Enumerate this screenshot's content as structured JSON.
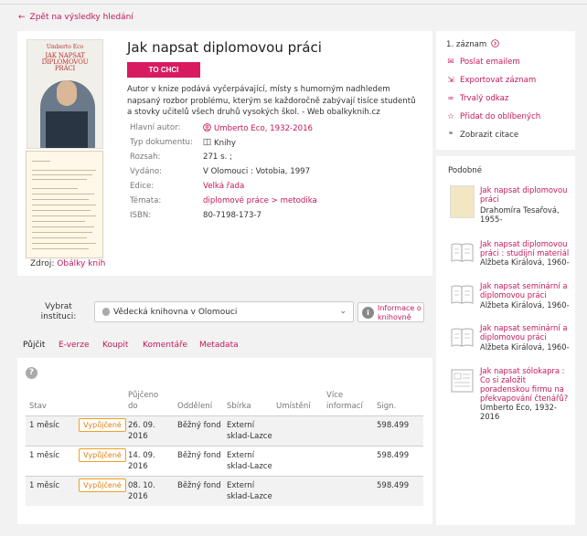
{
  "nav": {
    "back_label": "Zpět na výsledky hledání"
  },
  "record": {
    "cover": {
      "author_text": "Umberto Eco",
      "title_text": "JAK NAPSAT DIPLOMOVOU PRÁCI"
    },
    "title": "Jak napsat diplomovou práci",
    "want_button": "TO CHCI",
    "description": "Autor v knize podává vyčerpávající, místy s humorným nadhledem napsaný rozbor problému, kterým se každoročně zabývají tisíce studentů a stovky učitelů všech druhů vysokých škol. - Web obalkyknih.cz",
    "source_label": "Zdroj:",
    "source_link": "Obálky knih",
    "fields": [
      {
        "label": "Hlavní autor:",
        "value": "Umberto Eco, 1932-2016",
        "link": true,
        "icon": "person-icon"
      },
      {
        "label": "Typ dokumentu:",
        "value": "Knihy",
        "link": false,
        "icon": "book-icon"
      },
      {
        "label": "Rozsah:",
        "value": "271 s. ;",
        "link": false
      },
      {
        "label": "Vydáno:",
        "value": "V Olomouci : Votobia, 1997",
        "link": false
      },
      {
        "label": "Edice:",
        "value": "Velká řada",
        "link": true
      },
      {
        "label": "Témata:",
        "value": "diplomové práce > metodika",
        "link": true
      },
      {
        "label": "ISBN:",
        "value": "80-7198-173-7",
        "link": false
      }
    ]
  },
  "institution": {
    "label": "Vybrat instituci:",
    "selected": "Vědecká knihovna v Olomouci",
    "info_button": "Informace o knihovně"
  },
  "tabs": [
    "Půjčit",
    "E-verze",
    "Koupit",
    "Komentáře",
    "Metadata"
  ],
  "holdings": {
    "columns": [
      "Stav",
      "",
      "Půjčeno do",
      "Oddělení",
      "Sbírka",
      "Umístění",
      "Více informací",
      "Sign."
    ],
    "rows": [
      {
        "stav": "1 měsíc",
        "status": "Vypůjčené",
        "due": "26. 09. 2016",
        "dept": "Běžný fond",
        "coll": "Externí sklad-Lazce",
        "loc": "",
        "more": "",
        "sign": "598.499"
      },
      {
        "stav": "1 měsíc",
        "status": "Vypůjčené",
        "due": "14. 09. 2016",
        "dept": "Běžný fond",
        "coll": "Externí sklad-Lazce",
        "loc": "",
        "more": "",
        "sign": "598.499"
      },
      {
        "stav": "1 měsíc",
        "status": "Vypůjčené",
        "due": "08. 10. 2016",
        "dept": "Běžný fond",
        "coll": "Externí sklad-Lazce",
        "loc": "",
        "more": "",
        "sign": "598.499"
      }
    ]
  },
  "actions": {
    "record_nav": "1. záznam",
    "items": [
      {
        "label": "Poslat emailem",
        "icon": "envelope-icon"
      },
      {
        "label": "Exportovat záznam",
        "icon": "export-icon"
      },
      {
        "label": "Trvalý odkaz",
        "icon": "link-icon"
      },
      {
        "label": "Přidat do oblíbených",
        "icon": "star-icon"
      },
      {
        "label": "Zobrazit citace",
        "icon": "quote-icon"
      }
    ]
  },
  "similar": {
    "heading": "Podobné",
    "items": [
      {
        "title": "Jak napsat diplomovou práci",
        "author": "Drahomíra Tesařová, 1955-",
        "thumb": "cover"
      },
      {
        "title": "Jak napsat diplomovou práci : studijní materiál",
        "author": "Alžbeta Királová, 1960-",
        "thumb": "generic"
      },
      {
        "title": "Jak napsat seminární a diplomovou práci",
        "author": "Alžbeta Királová, 1960-",
        "thumb": "generic"
      },
      {
        "title": "Jak napsat seminární a diplomovou práci",
        "author": "Alžbeta Királová, 1960-",
        "thumb": "generic"
      },
      {
        "title": "Jak napsat sólokapra : Co si založit poradenskou firmu na překvapování čtenářů?",
        "author": "Umberto Eco, 1932-2016",
        "thumb": "doc"
      }
    ]
  }
}
